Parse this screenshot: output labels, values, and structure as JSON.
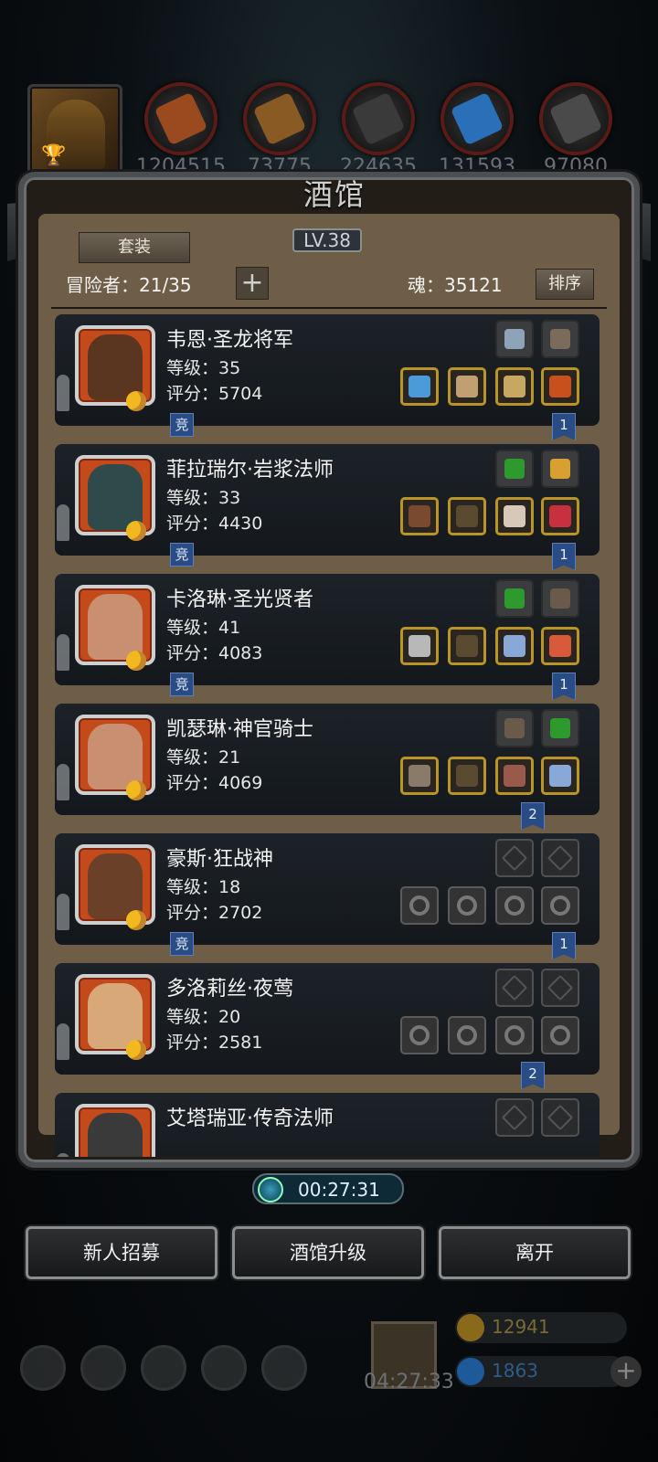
{
  "resources": [
    {
      "icon": "meat-icon",
      "value": "1204515",
      "color": "#9b4a20"
    },
    {
      "icon": "wood-icon",
      "value": "73775",
      "color": "#8a5a24"
    },
    {
      "icon": "stone-icon",
      "value": "224635",
      "color": "#3a3a3a"
    },
    {
      "icon": "crystal-icon",
      "value": "131593",
      "color": "#2a70b8"
    },
    {
      "icon": "iron-icon",
      "value": "97080",
      "color": "#4a4a4a"
    }
  ],
  "panel": {
    "title": "酒馆",
    "level": "LV.38",
    "suit_button": "套装",
    "adventurers_label": "冒险者：21/35",
    "soul_label": "魂：35121",
    "sort_button": "排序",
    "plus_label": "+"
  },
  "heroes": [
    {
      "name": "韦恩·圣龙将军",
      "level": "等级：35",
      "score": "评分：5704",
      "competition": "竞",
      "rank": "1",
      "equipped": true,
      "skills": [
        "#8ca3b8",
        "#7a6b5a"
      ],
      "gear": [
        "#4a9bd8",
        "#c0a070",
        "#c8a860",
        "#c8501c"
      ],
      "face": "#5a3520"
    },
    {
      "name": "菲拉瑞尔·岩浆法师",
      "level": "等级：33",
      "score": "评分：4430",
      "competition": "竞",
      "rank": "1",
      "equipped": true,
      "skills": [
        "#2e9a2e",
        "#d8a030"
      ],
      "gear": [
        "#7a4a30",
        "#5a4a30",
        "#d8c8b8",
        "#c83040"
      ],
      "face": "#2f4a4a"
    },
    {
      "name": "卡洛琳·圣光贤者",
      "level": "等级：41",
      "score": "评分：4083",
      "competition": "竞",
      "rank": "1",
      "equipped": true,
      "skills": [
        "#2e9a2e",
        "#6a5a4a"
      ],
      "gear": [
        "#b8b8b8",
        "#5a4a30",
        "#88a8d8",
        "#d85a3a"
      ],
      "face": "#c89070"
    },
    {
      "name": "凯瑟琳·神官骑士",
      "level": "等级：21",
      "score": "评分：4069",
      "competition": "",
      "rank": "2",
      "equipped": true,
      "skills": [
        "#6a5a4a",
        "#2e9a2e"
      ],
      "gear": [
        "#8a7a6a",
        "#5a4a30",
        "#9a5a4a",
        "#88a8d8"
      ],
      "face": "#c89070"
    },
    {
      "name": "豪斯·狂战神",
      "level": "等级：18",
      "score": "评分：2702",
      "competition": "竞",
      "rank": "1",
      "equipped": false,
      "skills": [],
      "gear": [],
      "face": "#6a4028"
    },
    {
      "name": "多洛莉丝·夜莺",
      "level": "等级：20",
      "score": "评分：2581",
      "competition": "",
      "rank": "2",
      "equipped": false,
      "skills": [],
      "gear": [],
      "face": "#d8a878"
    },
    {
      "name": "艾塔瑞亚·传奇法师",
      "level": "",
      "score": "",
      "competition": "",
      "rank": "",
      "equipped": false,
      "skills": [],
      "gear": [],
      "face": "#3a3a3a"
    }
  ],
  "timer": "00:27:31",
  "buttons": {
    "recruit": "新人招募",
    "upgrade": "酒馆升级",
    "leave": "离开"
  },
  "hud": {
    "gift_timer": "04:27:33",
    "gold": "12941",
    "gems": "1863",
    "plus": "+"
  },
  "colors": {
    "panel_bg": "#6e5e47",
    "card_bg": "#1d2228",
    "gold_border": "#b99525",
    "badge_blue": "#2a4c86"
  }
}
